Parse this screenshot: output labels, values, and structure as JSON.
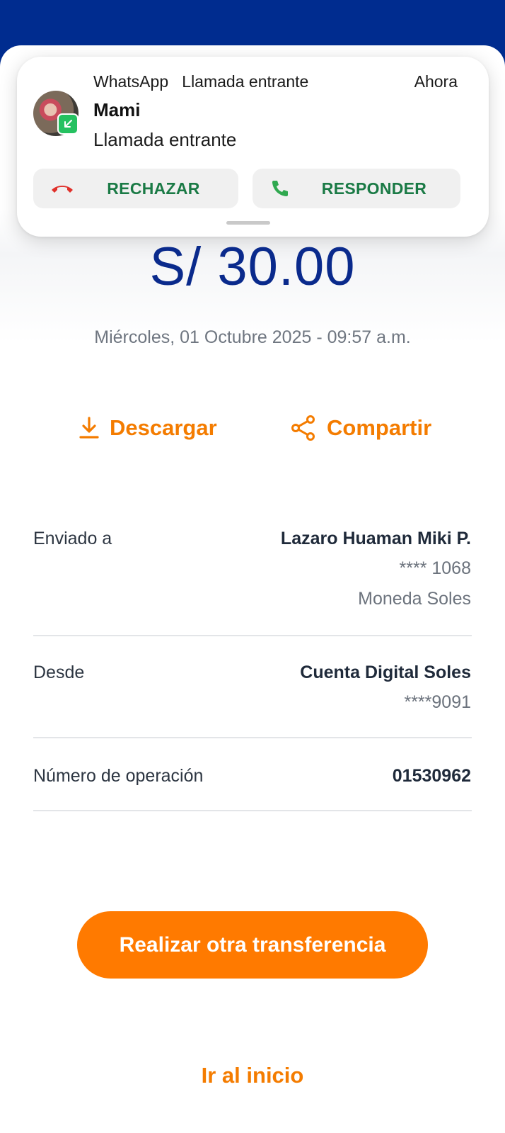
{
  "notification": {
    "app": "WhatsApp",
    "type": "Llamada entrante",
    "time": "Ahora",
    "caller": "Mami",
    "message": "Llamada entrante",
    "reject_label": "RECHAZAR",
    "answer_label": "RESPONDER"
  },
  "receipt": {
    "amount": "S/ 30.00",
    "datetime": "Miércoles, 01 Octubre 2025 - 09:57 a.m.",
    "download_label": "Descargar",
    "share_label": "Compartir",
    "details": {
      "sent_to": {
        "label": "Enviado a",
        "name": "Lazaro Huaman Miki P.",
        "account": "**** 1068",
        "currency": "Moneda Soles"
      },
      "from": {
        "label": "Desde",
        "name": "Cuenta Digital Soles",
        "account": "****9091"
      },
      "operation": {
        "label": "Número de operación",
        "number": "01530962"
      }
    }
  },
  "actions": {
    "primary": "Realizar otra transferencia",
    "secondary": "Ir al inicio"
  },
  "colors": {
    "brand_blue": "#002c8f",
    "accent_orange": "#ff7a00",
    "call_green": "#1a7a45",
    "reject_red": "#e0302a"
  }
}
